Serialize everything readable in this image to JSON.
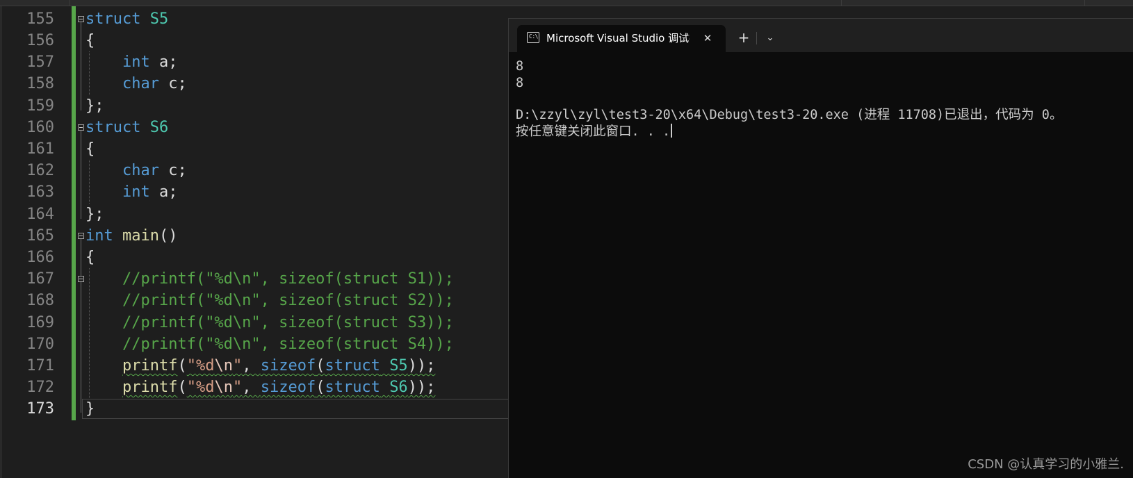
{
  "editor": {
    "line_numbers": [
      "155",
      "156",
      "157",
      "158",
      "159",
      "160",
      "161",
      "162",
      "163",
      "164",
      "165",
      "166",
      "167",
      "168",
      "169",
      "170",
      "171",
      "172",
      "173"
    ],
    "current_line": "173",
    "code": {
      "l155": {
        "kw": "struct",
        "name": "S5"
      },
      "l156": {
        "text": "{"
      },
      "l157": {
        "type": "int",
        "rest": "a;"
      },
      "l158": {
        "type": "char",
        "rest": "c;"
      },
      "l159": {
        "text": "};"
      },
      "l160": {
        "kw": "struct",
        "name": "S6"
      },
      "l161": {
        "text": "{"
      },
      "l162": {
        "type": "char",
        "rest": "c;"
      },
      "l163": {
        "type": "int",
        "rest": "a;"
      },
      "l164": {
        "text": "};"
      },
      "l165": {
        "type": "int",
        "fn": "main",
        "rest": "()"
      },
      "l166": {
        "text": "{"
      },
      "l167": {
        "comment": "//printf(\"%d\\n\", sizeof(struct S1));"
      },
      "l168": {
        "comment": "//printf(\"%d\\n\", sizeof(struct S2));"
      },
      "l169": {
        "comment": "//printf(\"%d\\n\", sizeof(struct S3));"
      },
      "l170": {
        "comment": "//printf(\"%d\\n\", sizeof(struct S4));"
      },
      "l171": {
        "fn": "printf",
        "open": "(",
        "q1": "\"",
        "fmt": "%d",
        "esc": "\\n",
        "q2": "\"",
        "comma": ", ",
        "sizeof": "sizeof",
        "p2": "(",
        "kw": "struct",
        "name": "S5",
        "close": "));"
      },
      "l172": {
        "fn": "printf",
        "open": "(",
        "q1": "\"",
        "fmt": "%d",
        "esc": "\\n",
        "q2": "\"",
        "comma": ", ",
        "sizeof": "sizeof",
        "p2": "(",
        "kw": "struct",
        "name": "S6",
        "close": "));"
      },
      "l173": {
        "text": "}"
      }
    }
  },
  "console": {
    "tab_title": "Microsoft Visual Studio 调试控制台",
    "tab_icon_text": "C:\\",
    "close_glyph": "✕",
    "new_tab_glyph": "+",
    "dropdown_glyph": "⌄",
    "output": [
      "8",
      "8",
      "",
      "D:\\zzyl\\zyl\\test3-20\\x64\\Debug\\test3-20.exe (进程 11708)已退出，代码为 0。",
      "按任意键关闭此窗口. . ."
    ]
  },
  "watermark": "CSDN @认真学习的小雅兰.",
  "colors": {
    "keyword": "#569cd6",
    "type_name": "#4ec9b0",
    "function": "#dcdcaa",
    "string": "#d69d85",
    "comment": "#57a64a",
    "change_bar": "#57a64a",
    "console_bg": "#0c0c0c",
    "editor_bg": "#1e1e1e"
  }
}
